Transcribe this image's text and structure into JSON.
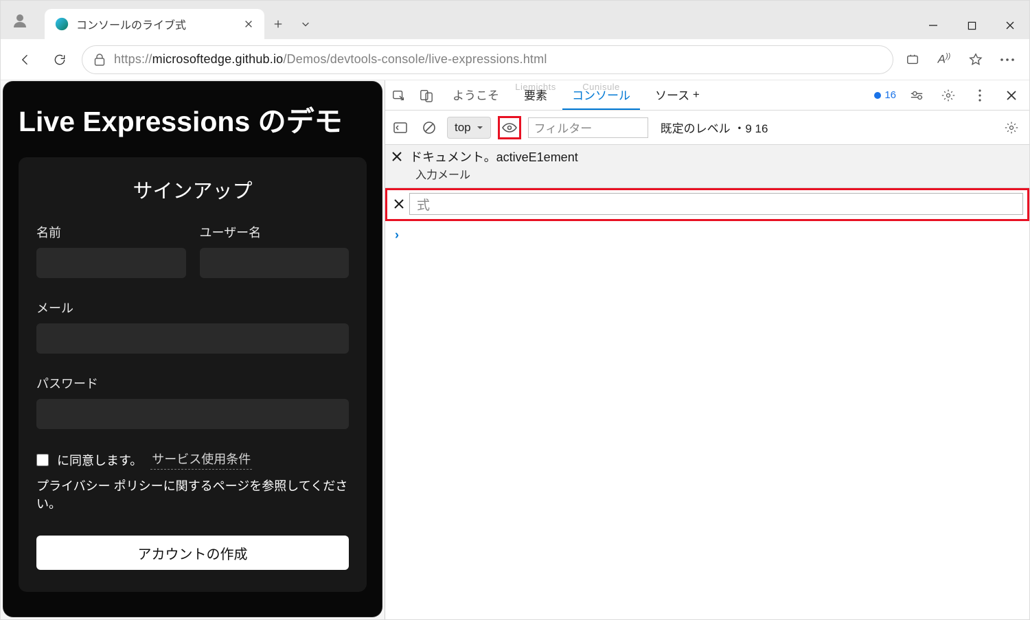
{
  "browser": {
    "tab_title": "コンソールのライブ式",
    "url_display": {
      "prefix": "https://",
      "host": "microsoftedge.github.io",
      "path": "/Demos/devtools-console/live-expressions.html"
    }
  },
  "page": {
    "heading": "Live Expressions のデモ",
    "form": {
      "title": "サインアップ",
      "name_label": "名前",
      "username_label": "ユーザー名",
      "email_label": "メール",
      "password_label": "パスワード",
      "agree_prefix": "に同意します。",
      "tos": "サービス使用条件",
      "privacy_link": "プライバシー ポリシーに関するページを参照してください。",
      "submit": "アカウントの作成"
    }
  },
  "devtools": {
    "tabs": {
      "welcome": "ようこそ",
      "elements": "要素",
      "elements_faded": "Liemichts",
      "console": "コンソール",
      "console_faded": "Cunisule",
      "sources": "ソース",
      "more": "+"
    },
    "issues_count": "16",
    "console_toolbar": {
      "context": "top",
      "filter_placeholder": "フィルター",
      "level": "既定のレベル",
      "hidden_count": "9 16"
    },
    "live_expressions": {
      "existing": {
        "expr": "ドキュメント。activeE1ement",
        "result": "入力メール"
      },
      "new_placeholder": "式"
    }
  }
}
